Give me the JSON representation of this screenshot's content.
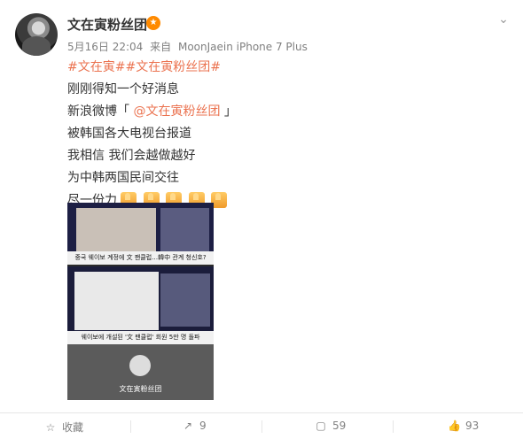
{
  "post": {
    "username": "文在寅粉丝团",
    "meta": {
      "date": "5月16日 22:04",
      "source_prefix": "来自",
      "source": "MoonJaein iPhone 7 Plus"
    },
    "lines": [
      {
        "type": "tags",
        "text": "#文在寅##文在寅粉丝团#"
      },
      {
        "type": "text",
        "text": "刚刚得知一个好消息"
      },
      {
        "type": "mention",
        "prefix": "新浪微博「 ",
        "mention": "@文在寅粉丝团",
        "suffix": " 」"
      },
      {
        "type": "text",
        "text": "被韩国各大电视台报道"
      },
      {
        "type": "text",
        "text": "我相信 我们会越做越好"
      },
      {
        "type": "text",
        "text": "为中韩两国民间交往"
      },
      {
        "type": "text",
        "text": "尽一份力"
      }
    ],
    "media": {
      "caption1": "중국 웨이보 계정에 文 팬클럽…韓中 관계 청신호?",
      "caption2": "웨이보에 개설된 '文 팬클럽' 회원 5만 명 돌파",
      "caption3": "文在寅粉丝团"
    }
  },
  "actions": {
    "collect_label": "收藏",
    "repost_count": "9",
    "comment_count": "59",
    "like_count": "93"
  }
}
